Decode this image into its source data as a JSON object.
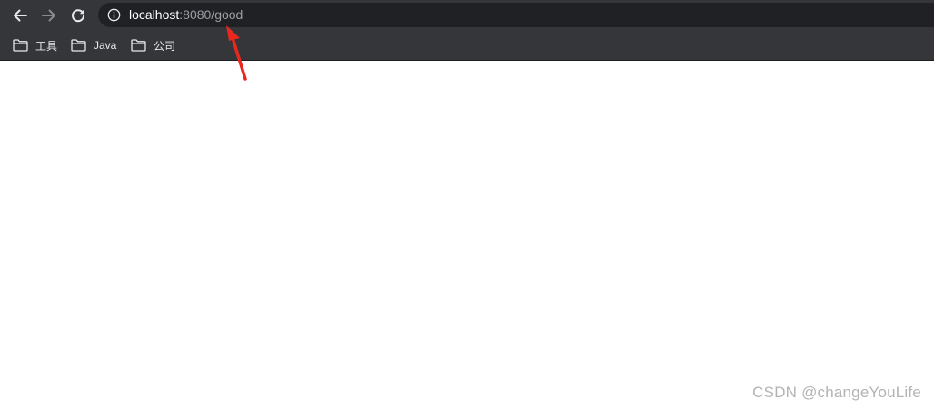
{
  "browser": {
    "url": {
      "host": "localhost",
      "rest": ":8080/good"
    }
  },
  "icons": {
    "back": "arrow-left-icon",
    "forward": "arrow-right-icon",
    "reload": "reload-icon",
    "site_info": "info-icon",
    "folder": "folder-icon"
  },
  "bookmarks": [
    {
      "label": "工具"
    },
    {
      "label": "Java"
    },
    {
      "label": "公司"
    }
  ],
  "annotation": {
    "color": "#e8281e"
  },
  "watermark": "CSDN @changeYouLife"
}
